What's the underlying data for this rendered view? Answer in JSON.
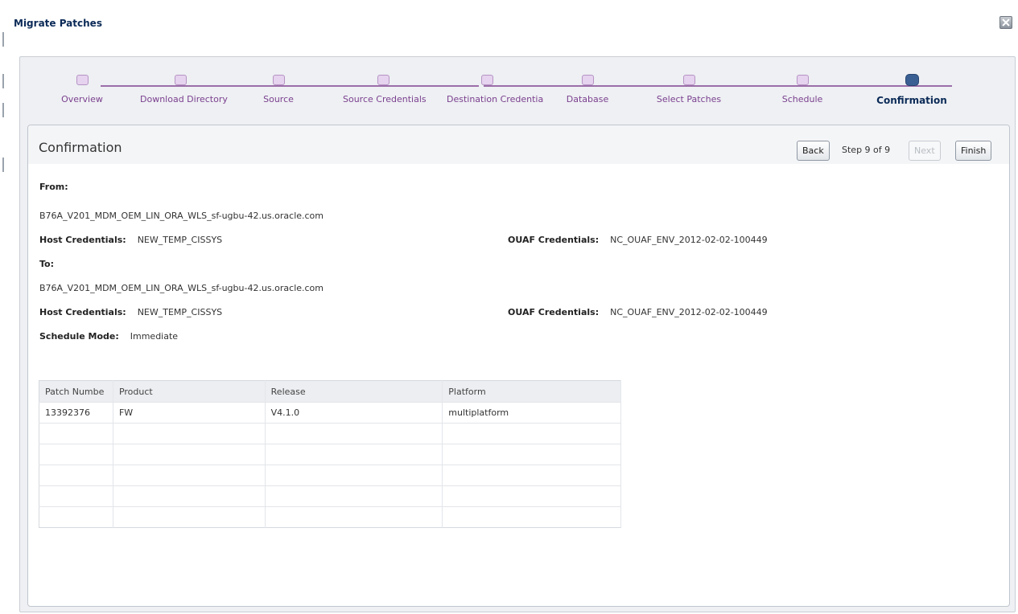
{
  "dialog": {
    "title": "Migrate Patches",
    "close_icon": "close-icon"
  },
  "train": {
    "steps": [
      {
        "label": "Overview"
      },
      {
        "label": "Download Directory"
      },
      {
        "label": "Source"
      },
      {
        "label": "Source Credentials"
      },
      {
        "label": "Destination Credentia"
      },
      {
        "label": "Database"
      },
      {
        "label": "Select Patches"
      },
      {
        "label": "Schedule"
      },
      {
        "label": "Confirmation"
      }
    ],
    "active_index": 8
  },
  "panel": {
    "title": "Confirmation",
    "back_label": "Back",
    "step_text": "Step 9 of 9",
    "next_label": "Next",
    "finish_label": "Finish"
  },
  "from": {
    "heading": "From:",
    "target": "B76A_V201_MDM_OEM_LIN_ORA_WLS_sf-ugbu-42.us.oracle.com",
    "host_cred_label": "Host Credentials:",
    "host_cred_value": "NEW_TEMP_CISSYS",
    "ouaf_cred_label": "OUAF Credentials:",
    "ouaf_cred_value": "NC_OUAF_ENV_2012-02-02-100449"
  },
  "to": {
    "heading": "To:",
    "target": "B76A_V201_MDM_OEM_LIN_ORA_WLS_sf-ugbu-42.us.oracle.com",
    "host_cred_label": "Host Credentials:",
    "host_cred_value": "NEW_TEMP_CISSYS",
    "ouaf_cred_label": "OUAF Credentials:",
    "ouaf_cred_value": "NC_OUAF_ENV_2012-02-02-100449"
  },
  "schedule": {
    "label": "Schedule Mode:",
    "value": "Immediate"
  },
  "table": {
    "headers": [
      "Patch Numbe",
      "Product",
      "Release",
      "Platform"
    ],
    "rows": [
      [
        "13392376",
        "FW",
        "V4.1.0",
        "multiplatform"
      ]
    ],
    "empty_rows": 5
  },
  "colors": {
    "train_line": "#9b6ea8",
    "train_label": "#7b3f8f",
    "active_step": "#3a5f93",
    "title": "#0b2a57"
  }
}
